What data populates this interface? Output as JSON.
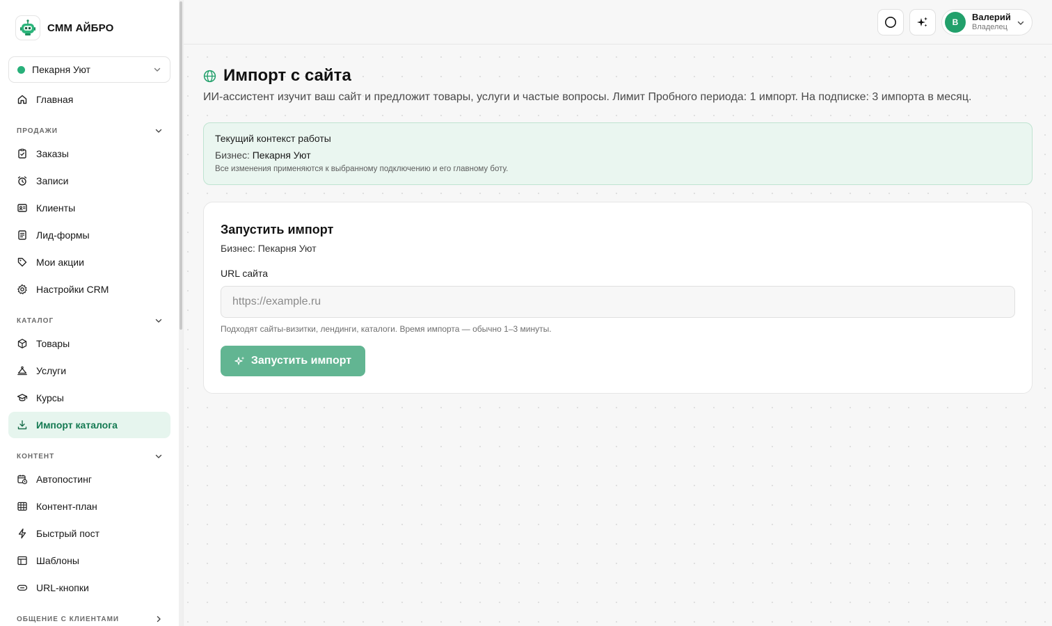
{
  "brand": {
    "name": "СММ АЙБРО"
  },
  "business_selector": {
    "value": "Пекарня Уют",
    "status_color": "#28b07a"
  },
  "sidebar": {
    "home": {
      "label": "Главная",
      "icon": "home-icon"
    },
    "sections": [
      {
        "title": "ПРОДАЖИ",
        "items": [
          {
            "label": "Заказы",
            "icon": "clipboard-icon"
          },
          {
            "label": "Записи",
            "icon": "alarm-clock-icon"
          },
          {
            "label": "Клиенты",
            "icon": "contact-card-icon"
          },
          {
            "label": "Лид-формы",
            "icon": "form-icon"
          },
          {
            "label": "Мои акции",
            "icon": "tag-icon"
          },
          {
            "label": "Настройки CRM",
            "icon": "gear-icon"
          }
        ]
      },
      {
        "title": "КАТАЛОГ",
        "items": [
          {
            "label": "Товары",
            "icon": "box-icon"
          },
          {
            "label": "Услуги",
            "icon": "service-icon"
          },
          {
            "label": "Курсы",
            "icon": "graduation-cap-icon"
          },
          {
            "label": "Импорт каталога",
            "icon": "download-icon",
            "active": true
          }
        ]
      },
      {
        "title": "КОНТЕНТ",
        "items": [
          {
            "label": "Автопостинг",
            "icon": "calendar-clock-icon"
          },
          {
            "label": "Контент-план",
            "icon": "grid-calendar-icon"
          },
          {
            "label": "Быстрый пост",
            "icon": "lightning-icon"
          },
          {
            "label": "Шаблоны",
            "icon": "layout-icon"
          },
          {
            "label": "URL-кнопки",
            "icon": "link-button-icon"
          }
        ]
      },
      {
        "title": "ОБЩЕНИЕ С КЛИЕНТАМИ",
        "items": []
      }
    ]
  },
  "topbar": {
    "user": {
      "initial": "В",
      "name": "Валерий",
      "role": "Владелец"
    }
  },
  "page": {
    "title": "Импорт с сайта",
    "description": "ИИ-ассистент изучит ваш сайт и предложит товары, услуги и частые вопросы. Лимит Пробного периода: 1 импорт. На подписке: 3 импорта в месяц."
  },
  "context": {
    "title": "Текущий контекст работы",
    "business_label": "Бизнес:",
    "business_value": "Пекарня Уют",
    "note": "Все изменения применяются к выбранному подключению и его главному боту."
  },
  "import_card": {
    "title": "Запустить импорт",
    "business_label": "Бизнес:",
    "business_value": "Пекарня Уют",
    "url_label": "URL сайта",
    "url_value": "",
    "url_placeholder": "https://example.ru",
    "hint": "Подходят сайты-визитки, лендинги, каталоги. Время импорта — обычно 1–3 минуты.",
    "button_label": "Запустить импорт"
  },
  "colors": {
    "accent": "#22a06b",
    "active_bg": "#e6f5ee",
    "active_text": "#147a52",
    "button": "#62b592",
    "context_bg": "#eaf6f0"
  }
}
